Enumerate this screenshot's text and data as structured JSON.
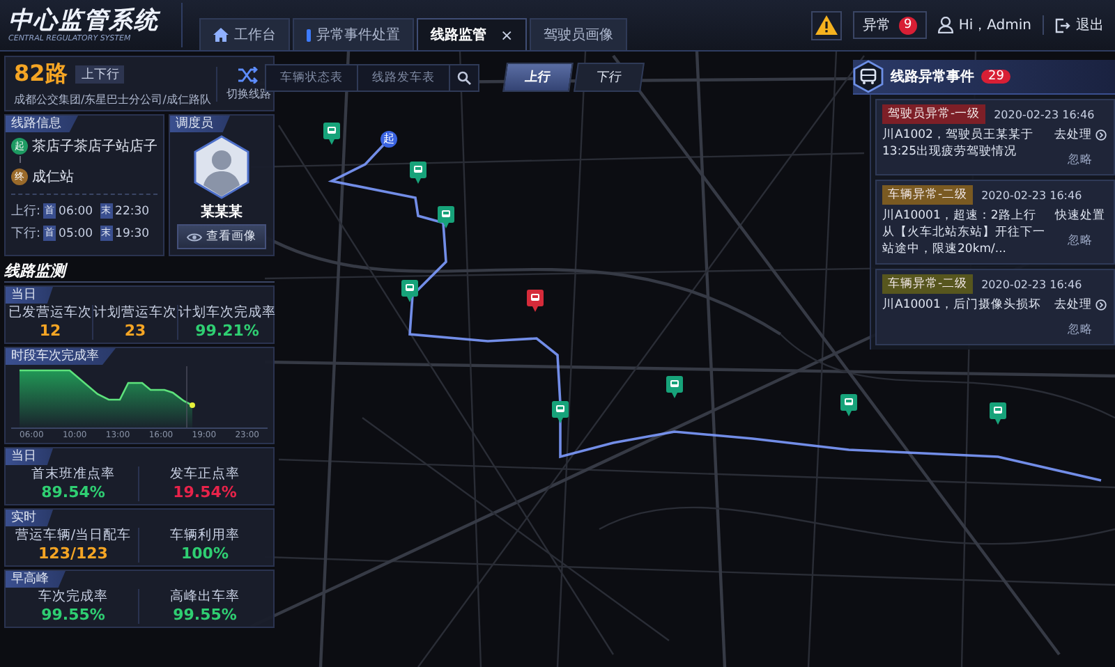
{
  "header": {
    "title": "中心监管系统",
    "subtitle": "CENTRAL REGULATORY SYSTEM",
    "tabs": [
      {
        "label": "工作台",
        "selected": false,
        "kind": "home"
      },
      {
        "label": "异常事件处置",
        "selected": false,
        "kind": "marked"
      },
      {
        "label": "线路监管",
        "selected": true,
        "kind": "plain",
        "close": "×"
      },
      {
        "label": "驾驶员画像",
        "selected": false,
        "kind": "plain"
      }
    ],
    "alert_label": "异常",
    "alert_count": "9",
    "user": "Hi，Admin",
    "logout": "退出"
  },
  "route": {
    "name": "82路",
    "direction_badge": "上下行",
    "company": "成都公交集团/东星巴士分公司/成仁路队",
    "switch_label": "切换线路"
  },
  "line_info": {
    "title": "线路信息",
    "stops": [
      {
        "badge": "起",
        "name": "茶店子茶店子站店子",
        "kind": "start"
      },
      {
        "badge": "终",
        "name": "成仁站",
        "kind": "end"
      }
    ],
    "schedules": [
      {
        "label": "上行:",
        "first_badge": "首",
        "first": "06:00",
        "last_badge": "末",
        "last": "22:30"
      },
      {
        "label": "下行:",
        "first_badge": "首",
        "first": "05:00",
        "last_badge": "末",
        "last": "19:30"
      }
    ]
  },
  "dispatcher": {
    "title": "调度员",
    "name": "某某某",
    "button": "查看画像"
  },
  "monitor": {
    "title": "线路监测",
    "cards": [
      {
        "kind": "stats",
        "title": "当日",
        "stats": [
          {
            "label": "已发营运车次",
            "value": "12",
            "color": "#f5a524"
          },
          {
            "label": "计划营运车次",
            "value": "23",
            "color": "#f5a524"
          },
          {
            "label": "计划车次完成率",
            "value": "99.21%",
            "color": "#2fcf72"
          }
        ]
      },
      {
        "kind": "sparkline",
        "title": "时段车次完成率",
        "xticks": [
          "06:00",
          "10:00",
          "13:00",
          "16:00",
          "19:00",
          "23:00"
        ]
      },
      {
        "kind": "stats",
        "title": "当日",
        "stats": [
          {
            "label": "首末班准点率",
            "value": "89.54%",
            "color": "#2fcf72"
          },
          {
            "label": "发车正点率",
            "value": "19.54%",
            "color": "#e8234a"
          }
        ]
      },
      {
        "kind": "stats",
        "title": "实时",
        "stats": [
          {
            "label": "营运车辆/当日配车",
            "value": "123/123",
            "color": "#f5a524"
          },
          {
            "label": "车辆利用率",
            "value": "100%",
            "color": "#2fcf72"
          }
        ]
      },
      {
        "kind": "stats",
        "title": "早高峰",
        "stats": [
          {
            "label": "车次完成率",
            "value": "99.55%",
            "color": "#2fcf72"
          },
          {
            "label": "高峰出车率",
            "value": "99.55%",
            "color": "#2fcf72"
          }
        ]
      }
    ]
  },
  "toolbar": {
    "buttons": [
      "车辆状态表",
      "线路发车表"
    ],
    "directions": [
      {
        "label": "上行",
        "selected": true
      },
      {
        "label": "下行",
        "selected": false
      }
    ]
  },
  "map": {
    "start_badge": "起",
    "stops": [
      {
        "alert": false
      },
      {
        "alert": false
      },
      {
        "alert": false
      },
      {
        "alert": false
      },
      {
        "alert": true
      },
      {
        "alert": false
      },
      {
        "alert": false
      },
      {
        "alert": false
      },
      {
        "alert": false
      }
    ]
  },
  "events": {
    "title": "线路异常事件",
    "count": "29",
    "items": [
      {
        "tag": "驾驶员异常-一级",
        "color": "#7d1f27",
        "time": "2020-02-23  16:46",
        "text": "川A1002，驾驶员王某某于13:25出现疲劳驾驶情况",
        "action": "去处理",
        "action_arrow": true,
        "dismiss": "忽略"
      },
      {
        "tag": "车辆异常-二级",
        "color": "#7a5a22",
        "time": "2020-02-23  16:46",
        "text": "川A10001，超速：2路上行从【火车北站东站】开往下一站途中，限速20km/...",
        "action": "快速处置",
        "action_arrow": false,
        "dismiss": "忽略"
      },
      {
        "tag": "车辆异常-二级",
        "color": "#57561e",
        "time": "2020-02-23  16:46",
        "text": "川A10001，后门摄像头损坏",
        "action": "去处理",
        "action_arrow": true,
        "dismiss": "忽略"
      }
    ]
  }
}
